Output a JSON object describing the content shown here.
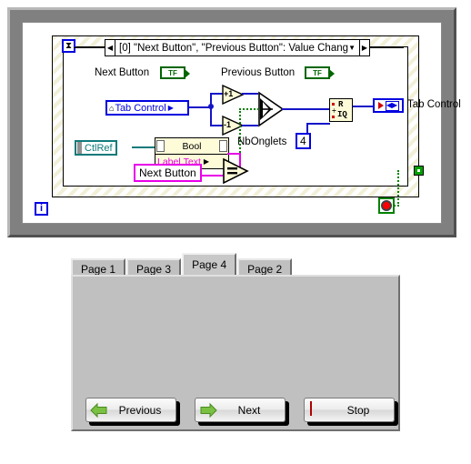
{
  "block_diagram": {
    "event_case": {
      "label": "[0] \"Next Button\", \"Previous Button\": Value Change",
      "left_arrow": "◀",
      "right_arrow": "▶",
      "caret": "▼"
    },
    "timeout_terminal_icon": "hourglass-icon",
    "timeout_glyph": "⧗",
    "terminals": {
      "next_button_label": "Next Button",
      "next_button_value": "TF",
      "previous_button_label": "Previous Button",
      "previous_button_value": "TF"
    },
    "tab_control_ref": {
      "home_glyph": "⌂",
      "label": "Tab Control",
      "arrow": "▶"
    },
    "tab_control_local": {
      "label": "Tab Control",
      "lr_glyph": "◀▶"
    },
    "functions": {
      "increment_label": "+1",
      "decrement_label": "-1",
      "select_name": "select-node",
      "equal_name": "equal-node",
      "quotient_remainder_top": "R",
      "quotient_remainder_bottom": "IQ",
      "quotient_remainder_div": "÷"
    },
    "nb_onglets": {
      "label": "NbOnglets",
      "value": "4"
    },
    "ctlref": {
      "label": "CtlRef"
    },
    "property_node": {
      "class_label": "Bool",
      "link_glyph": "✂",
      "property_label": "Label.Text",
      "property_arrow": "▶"
    },
    "string_constant": {
      "value": "Next Button"
    },
    "iteration_terminal": "i",
    "stop_terminal_name": "stop-button-terminal",
    "colors": {
      "wire_blue": "#1414c8",
      "wire_pink": "#e800e8",
      "wire_teal": "#0f7a7a",
      "wire_green": "#008000",
      "terminal_green": "#006600",
      "node_yellow": "#fdfbd8"
    }
  },
  "front_panel": {
    "tabs": [
      {
        "label": "Page 1",
        "active": false
      },
      {
        "label": "Page 3",
        "active": false
      },
      {
        "label": "Page 4",
        "active": true
      },
      {
        "label": "Page 2",
        "active": false
      }
    ],
    "buttons": [
      {
        "label": "Previous",
        "icon": "arrow-left-icon"
      },
      {
        "label": "Next",
        "icon": "arrow-right-icon"
      },
      {
        "label": "Stop",
        "icon": "stop-square-icon"
      }
    ]
  }
}
